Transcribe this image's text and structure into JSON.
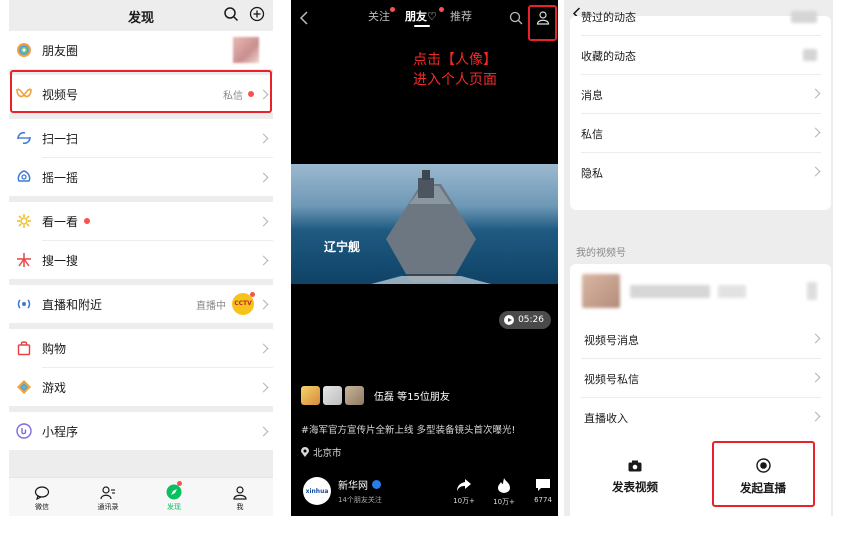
{
  "panel1": {
    "title": "发现",
    "items": [
      {
        "label": "朋友圈",
        "icon": "moments-icon"
      },
      {
        "label": "视频号",
        "icon": "channels-icon",
        "right_text": "私信"
      },
      {
        "label": "扫一扫",
        "icon": "scan-icon"
      },
      {
        "label": "摇一摇",
        "icon": "shake-icon"
      },
      {
        "label": "看一看",
        "icon": "top-stories-icon"
      },
      {
        "label": "搜一搜",
        "icon": "search-star-icon"
      },
      {
        "label": "直播和附近",
        "icon": "live-nearby-icon",
        "right_text": "直播中",
        "badge": "CCTV"
      },
      {
        "label": "购物",
        "icon": "shopping-bag-icon"
      },
      {
        "label": "游戏",
        "icon": "game-icon"
      },
      {
        "label": "小程序",
        "icon": "mini-program-icon"
      }
    ],
    "tabs": [
      {
        "label": "微信",
        "icon": "chat-icon"
      },
      {
        "label": "通讯录",
        "icon": "contacts-icon"
      },
      {
        "label": "发现",
        "icon": "compass-icon"
      },
      {
        "label": "我",
        "icon": "me-icon"
      }
    ],
    "colors": {
      "accent": "#07c160",
      "highlight": "#e8212a",
      "dot": "#fa5151"
    }
  },
  "panel2": {
    "tabs": [
      "关注",
      "朋友♡",
      "推荐"
    ],
    "annotation_line1": "点击【人像】",
    "annotation_line2": "进入个人页面",
    "video_caption": "辽宁舰",
    "duration": "05:26",
    "friends_text": "伍磊 等15位朋友",
    "description": "#海军官方宣传片全新上线 多型装备镜头首次曝光!",
    "location": "北京市",
    "author_name": "新华网",
    "author_sub": "14个朋友关注",
    "share_count": "10万+",
    "like_count": "10万+",
    "comment_count": "6774"
  },
  "panel3": {
    "top_items": [
      "赞过的动态",
      "收藏的动态",
      "消息",
      "私信",
      "隐私"
    ],
    "section_title": "我的视频号",
    "channel_items": [
      "视频号消息",
      "视频号私信",
      "直播收入"
    ],
    "btn_post": "发表视频",
    "btn_live": "发起直播"
  }
}
